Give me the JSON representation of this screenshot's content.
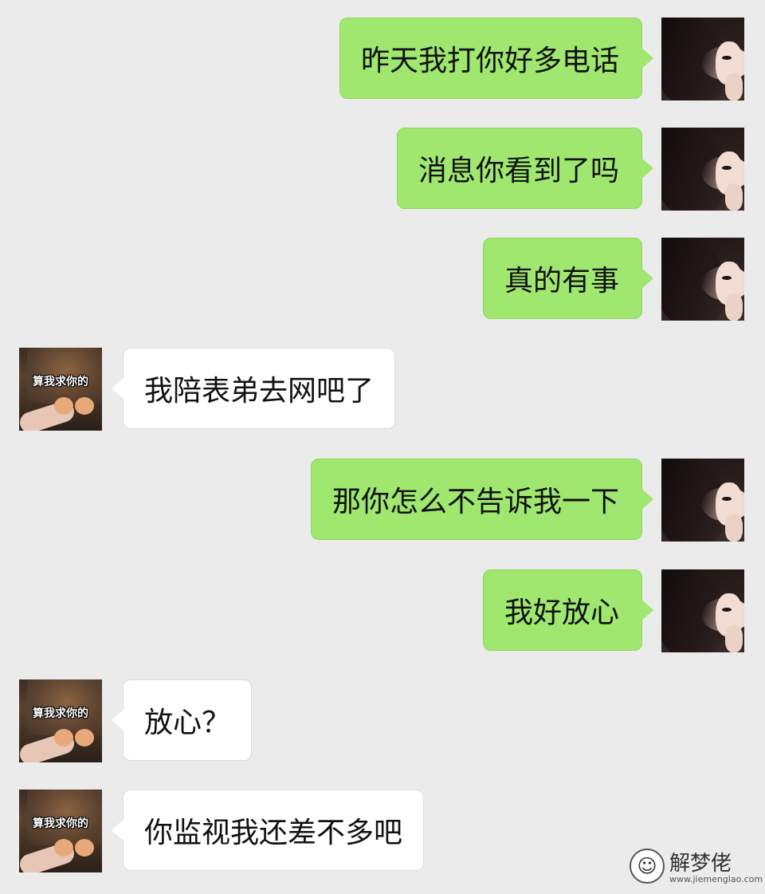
{
  "chat": {
    "messages": [
      {
        "side": "sent",
        "text": "昨天我打你好多电话"
      },
      {
        "side": "sent",
        "text": "消息你看到了吗"
      },
      {
        "side": "sent",
        "text": "真的有事"
      },
      {
        "side": "received",
        "text": "我陪表弟去网吧了"
      },
      {
        "side": "sent",
        "text": "那你怎么不告诉我一下"
      },
      {
        "side": "sent",
        "text": "我好放心"
      },
      {
        "side": "received",
        "text": "放心？"
      },
      {
        "side": "received",
        "text": "你监视我还差不多吧"
      }
    ],
    "received_avatar_caption": "算我求你的"
  },
  "watermark": {
    "title": "解梦佬",
    "url": "www.jiemenglao.com"
  },
  "colors": {
    "background": "#ebebeb",
    "sent_bubble": "#9fe76f",
    "received_bubble": "#ffffff"
  }
}
